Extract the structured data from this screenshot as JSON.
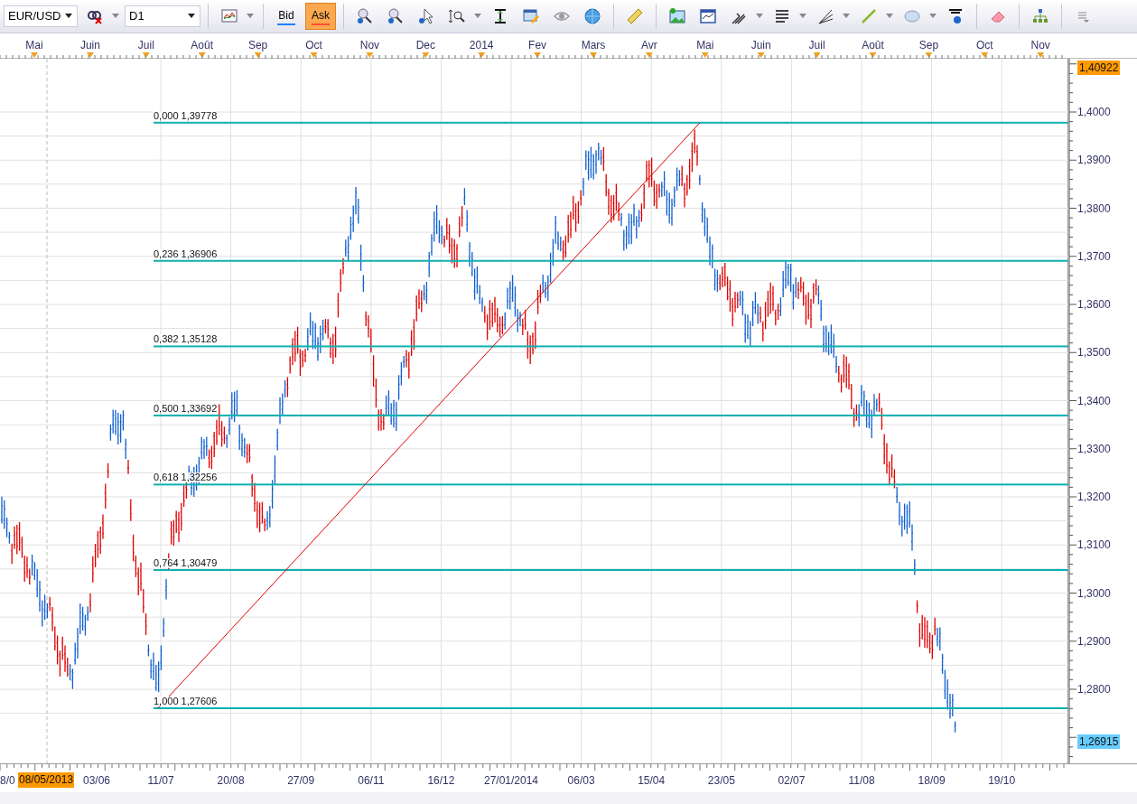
{
  "toolbar": {
    "symbol": "EUR/USD",
    "timeframe": "D1",
    "price_modes": [
      {
        "label": "Bid",
        "selected": false
      },
      {
        "label": "Ask",
        "selected": true
      }
    ]
  },
  "months": [
    "Mai",
    "Juin",
    "Juil",
    "Août",
    "Sep",
    "Oct",
    "Nov",
    "Dec",
    "2014",
    "Fev",
    "Mars",
    "Avr",
    "Mai",
    "Juin",
    "Juil",
    "Août",
    "Sep",
    "Oct",
    "Nov"
  ],
  "fibonacci_levels": [
    {
      "label": "0,000 1,39778"
    },
    {
      "label": "0,236 1,36906"
    },
    {
      "label": "0,382 1,35128"
    },
    {
      "label": "0,500 1,33692"
    },
    {
      "label": "0,618 1,32256"
    },
    {
      "label": "0,764 1,30479"
    },
    {
      "label": "1,000 1,27606"
    }
  ],
  "price_axis": {
    "high_label": "1,40922",
    "current_label": "1,26915",
    "ticks": [
      "1,4000",
      "1,3900",
      "1,3800",
      "1,3700",
      "1,3600",
      "1,3500",
      "1,3400",
      "1,3300",
      "1,3200",
      "1,3100",
      "1,3000",
      "1,2900",
      "1,2800"
    ]
  },
  "date_axis": {
    "cut_label": "8/0",
    "cursor_label": "08/05/2013",
    "dates": [
      "03/06",
      "11/07",
      "20/08",
      "27/09",
      "06/11",
      "16/12",
      "27/01/2014",
      "06/03",
      "15/04",
      "23/05",
      "02/07",
      "11/08",
      "18/09",
      "19/10"
    ]
  }
}
